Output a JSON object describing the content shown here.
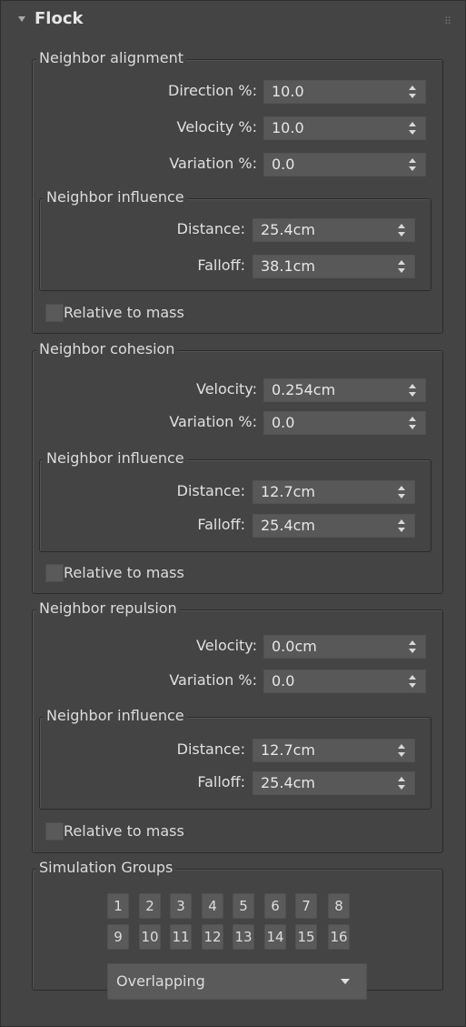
{
  "rollout": {
    "title": "Flock"
  },
  "alignment": {
    "title": "Neighbor alignment",
    "direction": {
      "label": "Direction %:",
      "value": "10.0"
    },
    "velocity": {
      "label": "Velocity %:",
      "value": "10.0"
    },
    "variation": {
      "label": "Variation %:",
      "value": "0.0"
    },
    "influence": {
      "title": "Neighbor influence",
      "distance": {
        "label": "Distance:",
        "value": "25.4cm"
      },
      "falloff": {
        "label": "Falloff:",
        "value": "38.1cm"
      }
    },
    "relative": {
      "label": "Relative to mass",
      "checked": false
    }
  },
  "cohesion": {
    "title": "Neighbor cohesion",
    "velocity": {
      "label": "Velocity:",
      "value": "0.254cm"
    },
    "variation": {
      "label": "Variation %:",
      "value": "0.0"
    },
    "influence": {
      "title": "Neighbor influence",
      "distance": {
        "label": "Distance:",
        "value": "12.7cm"
      },
      "falloff": {
        "label": "Falloff:",
        "value": "25.4cm"
      }
    },
    "relative": {
      "label": "Relative to mass",
      "checked": false
    }
  },
  "repulsion": {
    "title": "Neighbor repulsion",
    "velocity": {
      "label": "Velocity:",
      "value": "0.0cm"
    },
    "variation": {
      "label": "Variation %:",
      "value": "0.0"
    },
    "influence": {
      "title": "Neighbor influence",
      "distance": {
        "label": "Distance:",
        "value": "12.7cm"
      },
      "falloff": {
        "label": "Falloff:",
        "value": "25.4cm"
      }
    },
    "relative": {
      "label": "Relative to mass",
      "checked": false
    }
  },
  "sim_groups": {
    "title": "Simulation Groups",
    "buttons": [
      "1",
      "2",
      "3",
      "4",
      "5",
      "6",
      "7",
      "8",
      "9",
      "10",
      "11",
      "12",
      "13",
      "14",
      "15",
      "16"
    ],
    "mode": "Overlapping"
  },
  "icons": {
    "collapse": "triangle-down-icon",
    "grip": "drag-grip-icon",
    "spinner": "spinner-arrows-icon",
    "dropdown": "chevron-down-icon"
  },
  "colors": {
    "panel_bg": "#444444",
    "field_bg": "#585858",
    "text": "#dcdcdc",
    "border": "#2b2b2b"
  }
}
